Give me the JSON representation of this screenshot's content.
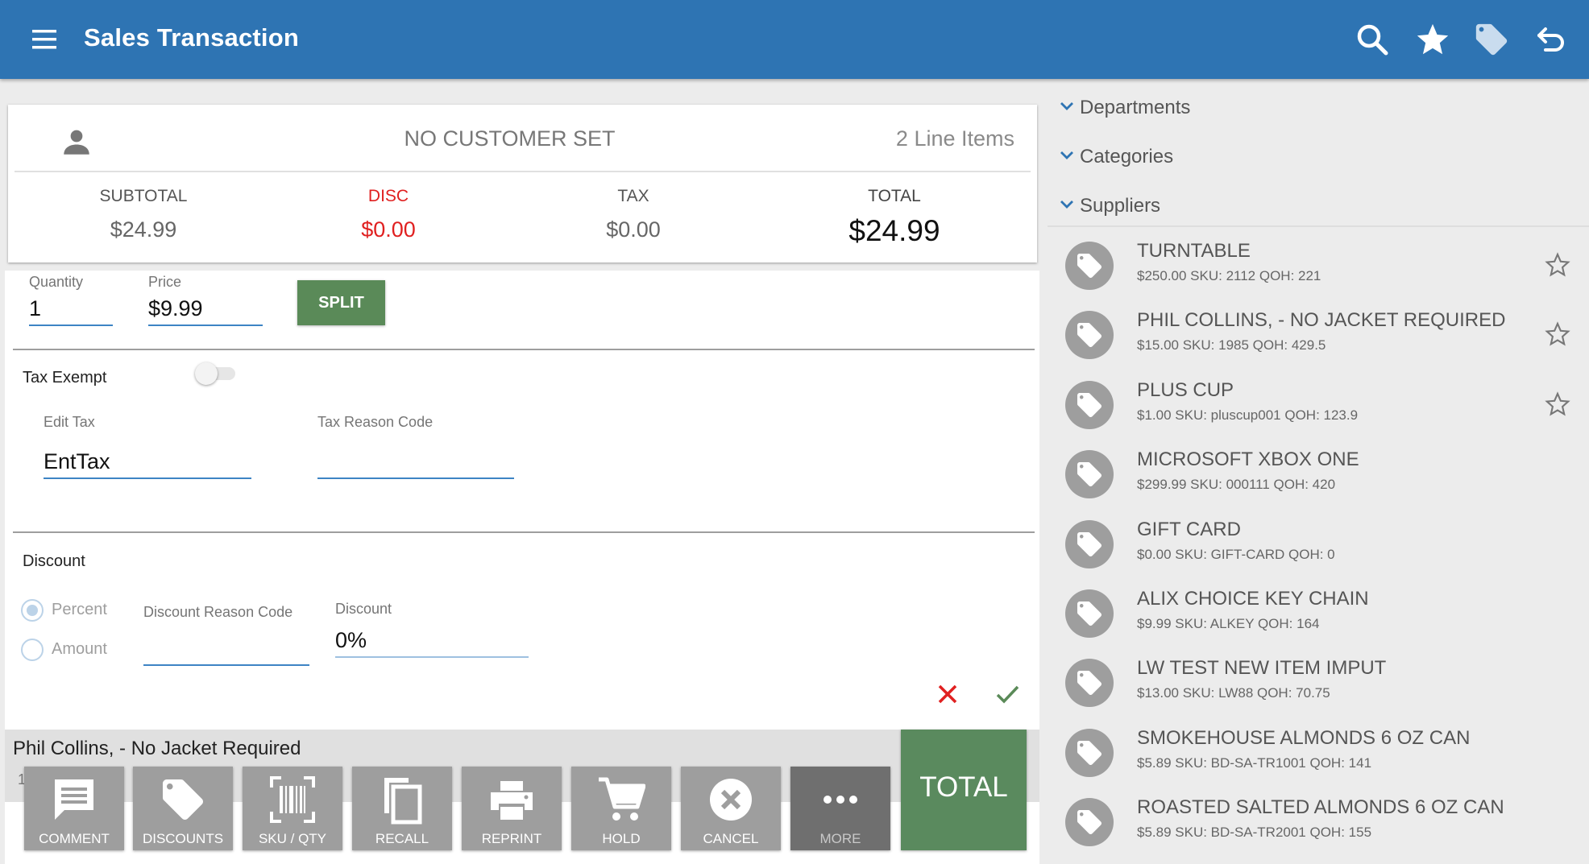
{
  "app": {
    "title": "Sales Transaction",
    "actions": [
      "search-icon",
      "star-icon",
      "tag-icon",
      "undo-icon"
    ],
    "bar_color": "#2e74b3"
  },
  "customer": {
    "name": "NO CUSTOMER SET",
    "line_items": "2 Line Items"
  },
  "totals": {
    "subtotal_label": "SUBTOTAL",
    "subtotal": "$24.99",
    "disc_label": "DISC",
    "disc": "$0.00",
    "tax_label": "TAX",
    "tax": "$0.00",
    "total_label": "TOTAL",
    "total": "$24.99"
  },
  "edit": {
    "quantity_label": "Quantity",
    "quantity": "1",
    "price_label": "Price",
    "price": "$9.99",
    "split_label": "SPLIT",
    "tax_exempt_label": "Tax Exempt",
    "tax_exempt": false,
    "edit_tax_label": "Edit Tax",
    "edit_tax": "EntTax",
    "tax_reason_label": "Tax Reason Code",
    "tax_reason": "",
    "discount_label": "Discount",
    "percent_label": "Percent",
    "amount_label": "Amount",
    "discount_mode": "Percent",
    "discount_reason_label": "Discount Reason Code",
    "discount_reason": "",
    "discount_value_label": "Discount",
    "discount_value": "0%"
  },
  "current_item": {
    "name": "Phil Collins, - No Jacket Required",
    "sub": "1"
  },
  "toolbar": [
    {
      "label": "COMMENT",
      "icon": "comment-icon"
    },
    {
      "label": "DISCOUNTS",
      "icon": "tag-icon"
    },
    {
      "label": "SKU / QTY",
      "icon": "barcode-icon"
    },
    {
      "label": "RECALL",
      "icon": "copy-icon"
    },
    {
      "label": "REPRINT",
      "icon": "printer-icon"
    },
    {
      "label": "HOLD",
      "icon": "cart-icon"
    },
    {
      "label": "CANCEL",
      "icon": "cancel-circle-icon"
    },
    {
      "label": "MORE",
      "icon": "more-icon"
    }
  ],
  "total_button": "TOTAL",
  "sidebar": {
    "sections": [
      "Departments",
      "Categories",
      "Suppliers"
    ],
    "products": [
      {
        "name": "TURNTABLE",
        "details": "$250.00 SKU: 2112 QOH: 221",
        "favorite_star": true
      },
      {
        "name": "PHIL COLLINS, - NO JACKET REQUIRED",
        "details": "$15.00 SKU: 1985 QOH: 429.5",
        "favorite_star": true
      },
      {
        "name": "PLUS CUP",
        "details": "$1.00 SKU: pluscup001 QOH: 123.9",
        "favorite_star": true
      },
      {
        "name": "MICROSOFT XBOX ONE",
        "details": "$299.99 SKU: 000111 QOH: 420",
        "favorite_star": false
      },
      {
        "name": "GIFT CARD",
        "details": "$0.00 SKU: GIFT-CARD QOH: 0",
        "favorite_star": false
      },
      {
        "name": "ALIX CHOICE KEY CHAIN",
        "details": "$9.99 SKU: ALKEY QOH: 164",
        "favorite_star": false
      },
      {
        "name": "LW TEST NEW ITEM IMPUT",
        "details": "$13.00 SKU: LW88 QOH: 70.75",
        "favorite_star": false
      },
      {
        "name": "SMOKEHOUSE ALMONDS 6 OZ CAN",
        "details": "$5.89 SKU: BD-SA-TR1001 QOH: 141",
        "favorite_star": false
      },
      {
        "name": "ROASTED SALTED ALMONDS 6 OZ CAN",
        "details": "$5.89 SKU: BD-SA-TR2001 QOH: 155",
        "favorite_star": false
      }
    ]
  }
}
